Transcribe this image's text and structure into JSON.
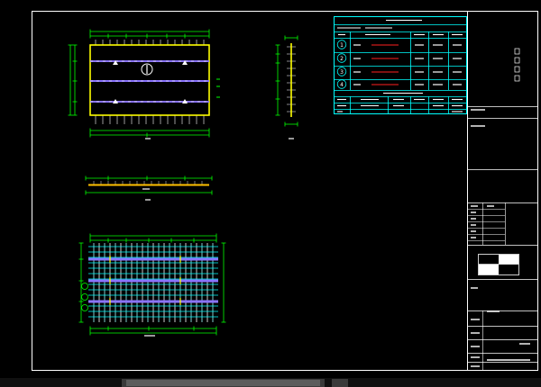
{
  "colors": {
    "background": "#000000",
    "frame": "#ffffff",
    "outline": "#ffff00",
    "dimension": "#00ff00",
    "table": "#00ffff",
    "rebar": "#c0c0c0",
    "rebar_band": "#8a74ff",
    "grid_alt": "#9fffff",
    "marker": "#ff2020",
    "section": "#ffc000",
    "scroll_track": "#3a3a3a",
    "scroll_thumb": "#5c5c5c"
  },
  "icons": {
    "orientation": "north-arrow-icon",
    "lifting_point": "triangle-marker-icon",
    "row_label": "circled-number-icon"
  },
  "spec_table": {
    "row_marks": [
      "1",
      "2",
      "3",
      "4"
    ]
  }
}
